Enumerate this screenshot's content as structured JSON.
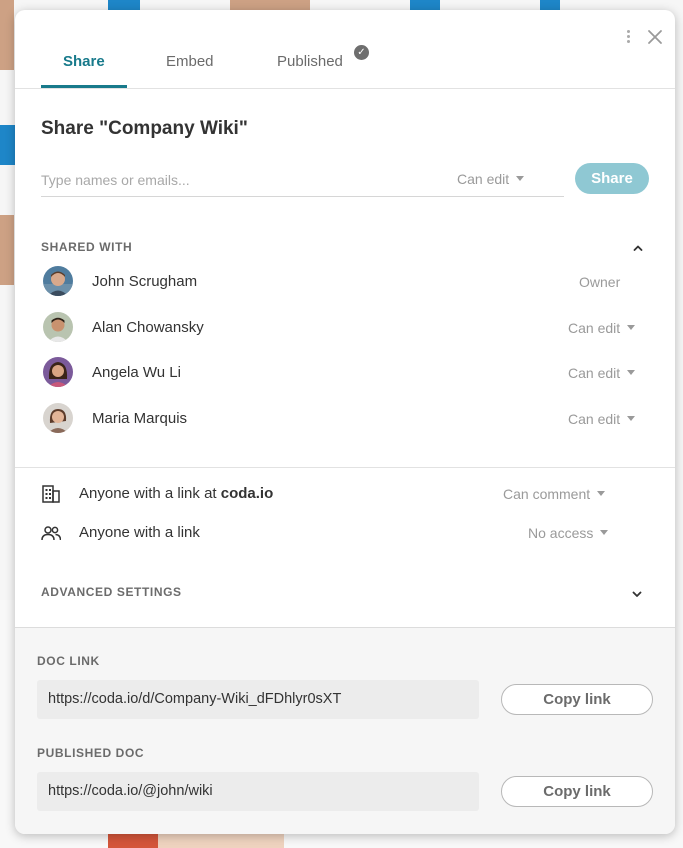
{
  "tabs": [
    {
      "label": "Share"
    },
    {
      "label": "Embed"
    },
    {
      "label": "Published"
    }
  ],
  "published_badge": "✓",
  "title": "Share \"Company Wiki\"",
  "invite": {
    "placeholder": "Type names or emails...",
    "permission": "Can edit",
    "share_label": "Share"
  },
  "shared_with": {
    "label": "SHARED WITH",
    "people": [
      {
        "name": "John Scrugham",
        "role": "Owner"
      },
      {
        "name": "Alan Chowansky",
        "role": "Can edit"
      },
      {
        "name": "Angela Wu Li",
        "role": "Can edit"
      },
      {
        "name": "Maria Marquis",
        "role": "Can edit"
      }
    ]
  },
  "link_access": {
    "org": {
      "prefix": "Anyone with a link at ",
      "domain": "coda.io",
      "permission": "Can comment"
    },
    "anyone": {
      "label": "Anyone with a link",
      "permission": "No access"
    }
  },
  "advanced": {
    "label": "ADVANCED SETTINGS"
  },
  "doc_link": {
    "label": "DOC LINK",
    "url": "https://coda.io/d/Company-Wiki_dFDhlyr0sXT",
    "copy_label": "Copy link"
  },
  "published_doc": {
    "label": "PUBLISHED DOC",
    "url": "https://coda.io/@john/wiki",
    "copy_label": "Copy link"
  },
  "colors": {
    "accent": "#187a8b",
    "share_button": "#8fc8d3"
  }
}
